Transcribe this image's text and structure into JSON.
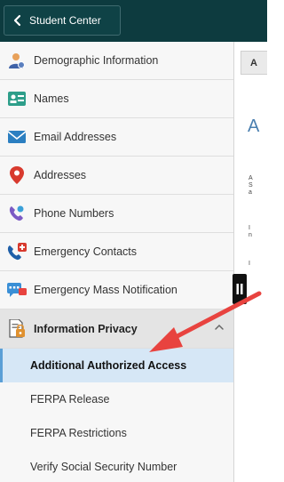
{
  "header": {
    "back_label": "Student Center"
  },
  "sidebar": {
    "items": [
      {
        "label": "Demographic Information",
        "icon": "person-icon"
      },
      {
        "label": "Names",
        "icon": "name-card-icon"
      },
      {
        "label": "Email Addresses",
        "icon": "envelope-icon"
      },
      {
        "label": "Addresses",
        "icon": "map-pin-icon"
      },
      {
        "label": "Phone Numbers",
        "icon": "phone-icon"
      },
      {
        "label": "Emergency Contacts",
        "icon": "emergency-phone-icon"
      },
      {
        "label": "Emergency Mass Notification",
        "icon": "chat-notification-icon"
      }
    ],
    "group": {
      "label": "Information Privacy",
      "icon": "privacy-document-icon",
      "expanded": true,
      "subitems": [
        {
          "label": "Additional Authorized Access",
          "active": true
        },
        {
          "label": "FERPA Release",
          "active": false
        },
        {
          "label": "FERPA Restrictions",
          "active": false
        },
        {
          "label": "Verify Social Security Number",
          "active": false
        }
      ]
    }
  },
  "content": {
    "tab_label": "A",
    "heading": "A",
    "text_fragments": [
      "A",
      "S",
      "a",
      "I",
      "n",
      "I"
    ]
  },
  "colors": {
    "topbar": "#0d3b3f",
    "active_item_bg": "#d6e7f6",
    "arrow": "#e8433f",
    "heading": "#4a7fb0"
  }
}
